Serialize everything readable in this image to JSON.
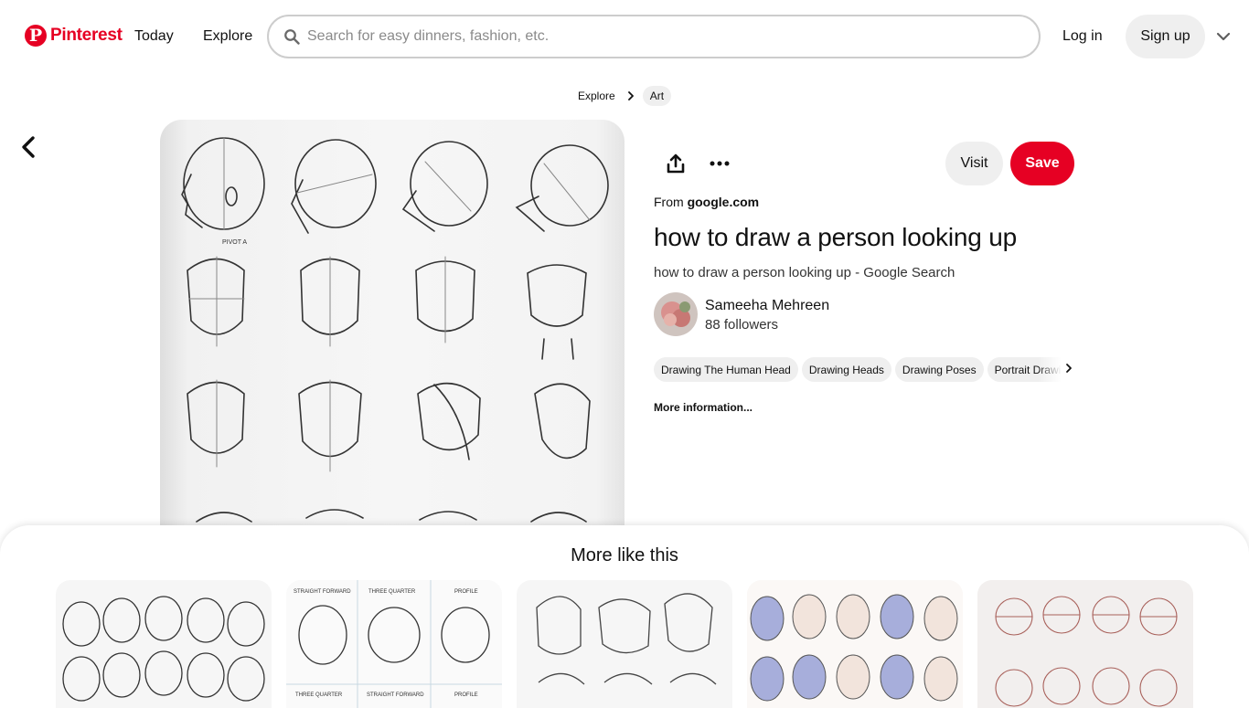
{
  "header": {
    "logo_mark": "P",
    "logo_text": "Pinterest",
    "nav": {
      "today": "Today",
      "explore": "Explore"
    },
    "search_placeholder": "Search for easy dinners, fashion, etc.",
    "login": "Log in",
    "signup": "Sign up"
  },
  "breadcrumb": {
    "explore": "Explore",
    "category": "Art"
  },
  "pin": {
    "visit": "Visit",
    "save": "Save",
    "from_label": "From",
    "from_domain": "google.com",
    "title": "how to draw a person looking up",
    "description": "how to draw a person looking up - Google Search",
    "image_label": "PIVOT A"
  },
  "user": {
    "name": "Sameeha Mehreen",
    "followers": "88 followers"
  },
  "tags": [
    "Drawing The Human Head",
    "Drawing Heads",
    "Drawing Poses",
    "Portrait Drawing"
  ],
  "more_information": "More information...",
  "more_like_this": {
    "title": "More like this",
    "thumb2_labels": [
      "STRAIGHT FORWARD",
      "THREE QUARTER",
      "PROFILE",
      "THREE QUARTER",
      "STRAIGHT FORWARD",
      "PROFILE"
    ]
  },
  "colors": {
    "brand": "#e60023",
    "pill": "#efefef"
  }
}
